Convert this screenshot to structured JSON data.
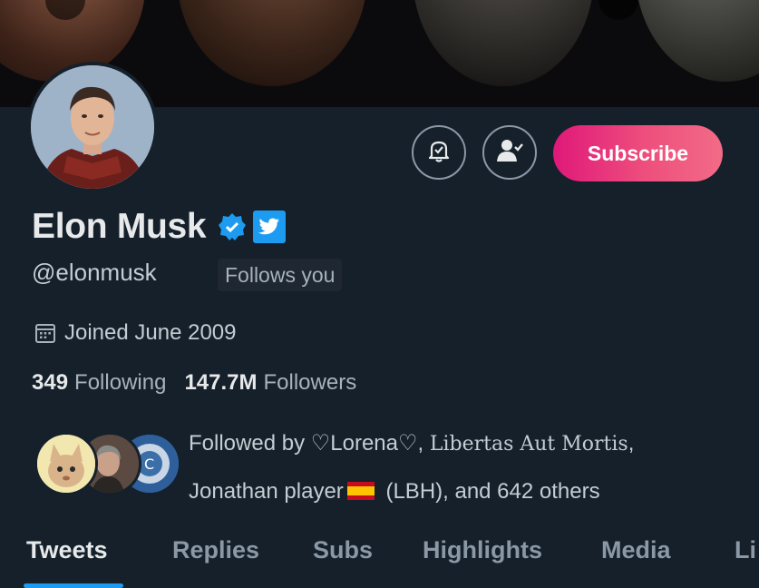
{
  "profile": {
    "name": "Elon Musk",
    "handle": "@elonmusk",
    "follows_you": "Follows you",
    "joined": "Joined June 2009",
    "following_count": "349",
    "following_label": "Following",
    "followers_count": "147.7M",
    "followers_label": "Followers"
  },
  "actions": {
    "subscribe_label": "Subscribe",
    "notifications_icon": "bell-check-icon",
    "follow_icon": "person-check-icon"
  },
  "followed_by": {
    "prefix": "Followed by ",
    "name1": "♡Lorena♡",
    "sep1": ", ",
    "name2": "Libertas Aut Mortis",
    "sep2": ",",
    "name3": "Jonathan player",
    "suffix": " (LBH), and 642 others"
  },
  "tabs": [
    {
      "label": "Tweets",
      "active": true
    },
    {
      "label": "Replies",
      "active": false
    },
    {
      "label": "Subs",
      "active": false
    },
    {
      "label": "Highlights",
      "active": false
    },
    {
      "label": "Media",
      "active": false
    },
    {
      "label": "Li",
      "active": false
    }
  ],
  "colors": {
    "background": "#15202b",
    "accent": "#1d9bf0",
    "subscribe_gradient_start": "#e0187a",
    "subscribe_gradient_end": "#f26b86"
  }
}
